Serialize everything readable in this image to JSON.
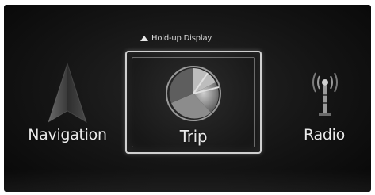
{
  "hint": {
    "text": "Hold-up Display"
  },
  "tiles": [
    {
      "label": "Navigation",
      "icon": "navigation-arrow-icon"
    },
    {
      "label": "Trip",
      "icon": "trip-chart-icon",
      "selected": true
    },
    {
      "label": "Radio",
      "icon": "radio-antenna-icon"
    }
  ]
}
